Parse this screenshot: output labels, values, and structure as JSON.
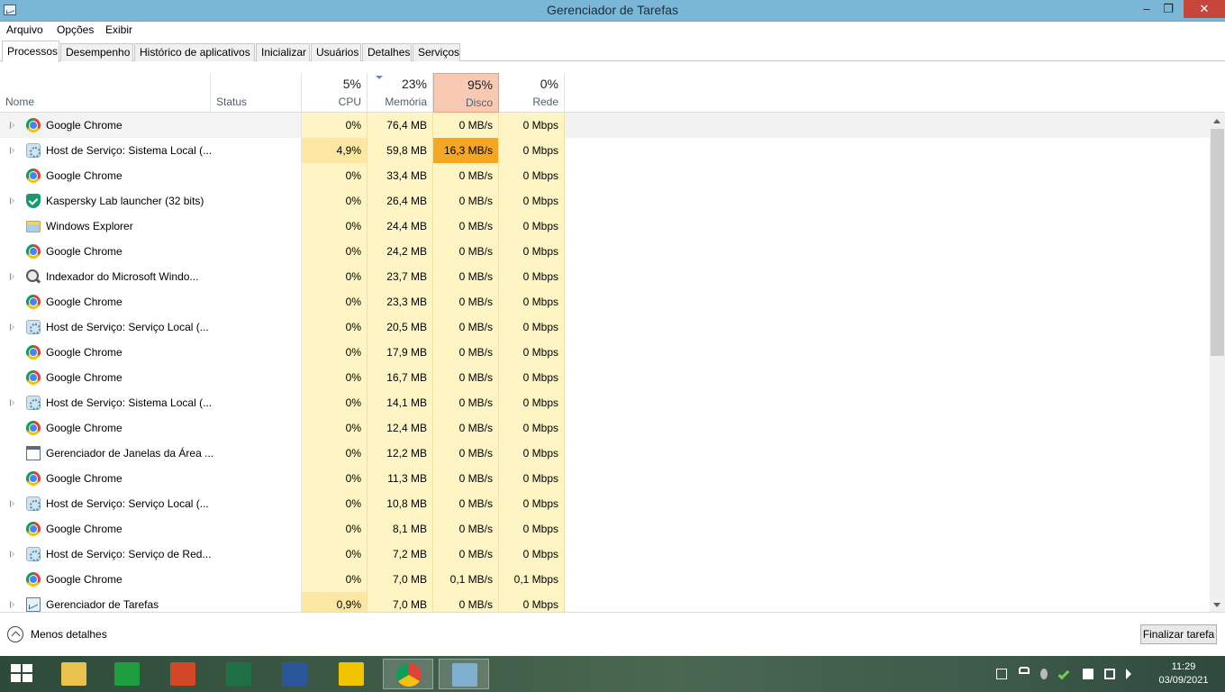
{
  "window": {
    "title": "Gerenciador de Tarefas"
  },
  "menu": [
    "Arquivo",
    "Opções",
    "Exibir"
  ],
  "tabs": [
    {
      "label": "Processos",
      "active": true
    },
    {
      "label": "Desempenho"
    },
    {
      "label": "Histórico de aplicativos"
    },
    {
      "label": "Inicializar"
    },
    {
      "label": "Usuários"
    },
    {
      "label": "Detalhes"
    },
    {
      "label": "Serviços"
    }
  ],
  "columns": {
    "name": "Nome",
    "status": "Status",
    "cpu": {
      "pct": "5%",
      "label": "CPU"
    },
    "memory": {
      "pct": "23%",
      "label": "Memória"
    },
    "disk": {
      "pct": "95%",
      "label": "Disco"
    },
    "network": {
      "pct": "0%",
      "label": "Rede"
    }
  },
  "processes": [
    {
      "name": "Google Chrome",
      "icon": "chrome-icon",
      "expandable": true,
      "cpu": "0%",
      "mem": "76,4 MB",
      "disk": "0 MB/s",
      "net": "0 Mbps",
      "selected": true
    },
    {
      "name": "Host de Serviço: Sistema Local (...",
      "icon": "gear-icon",
      "expandable": true,
      "cpu": "4,9%",
      "mem": "59,8 MB",
      "disk": "16,3 MB/s",
      "net": "0 Mbps",
      "cpu_hot": true,
      "disk_hot": true
    },
    {
      "name": "Google Chrome",
      "icon": "chrome-icon",
      "expandable": false,
      "cpu": "0%",
      "mem": "33,4 MB",
      "disk": "0 MB/s",
      "net": "0 Mbps"
    },
    {
      "name": "Kaspersky Lab launcher (32 bits)",
      "icon": "shield-icon",
      "expandable": true,
      "cpu": "0%",
      "mem": "26,4 MB",
      "disk": "0 MB/s",
      "net": "0 Mbps"
    },
    {
      "name": "Windows Explorer",
      "icon": "folder-icon",
      "expandable": false,
      "cpu": "0%",
      "mem": "24,4 MB",
      "disk": "0 MB/s",
      "net": "0 Mbps"
    },
    {
      "name": "Google Chrome",
      "icon": "chrome-icon",
      "expandable": false,
      "cpu": "0%",
      "mem": "24,2 MB",
      "disk": "0 MB/s",
      "net": "0 Mbps"
    },
    {
      "name": "Indexador do Microsoft Windo...",
      "icon": "indexer-icon",
      "expandable": true,
      "cpu": "0%",
      "mem": "23,7 MB",
      "disk": "0 MB/s",
      "net": "0 Mbps"
    },
    {
      "name": "Google Chrome",
      "icon": "chrome-icon",
      "expandable": false,
      "cpu": "0%",
      "mem": "23,3 MB",
      "disk": "0 MB/s",
      "net": "0 Mbps"
    },
    {
      "name": "Host de Serviço: Serviço Local (...",
      "icon": "gear-icon",
      "expandable": true,
      "cpu": "0%",
      "mem": "20,5 MB",
      "disk": "0 MB/s",
      "net": "0 Mbps"
    },
    {
      "name": "Google Chrome",
      "icon": "chrome-icon",
      "expandable": false,
      "cpu": "0%",
      "mem": "17,9 MB",
      "disk": "0 MB/s",
      "net": "0 Mbps"
    },
    {
      "name": "Google Chrome",
      "icon": "chrome-icon",
      "expandable": false,
      "cpu": "0%",
      "mem": "16,7 MB",
      "disk": "0 MB/s",
      "net": "0 Mbps"
    },
    {
      "name": "Host de Serviço: Sistema Local (...",
      "icon": "gear-icon",
      "expandable": true,
      "cpu": "0%",
      "mem": "14,1 MB",
      "disk": "0 MB/s",
      "net": "0 Mbps"
    },
    {
      "name": "Google Chrome",
      "icon": "chrome-icon",
      "expandable": false,
      "cpu": "0%",
      "mem": "12,4 MB",
      "disk": "0 MB/s",
      "net": "0 Mbps"
    },
    {
      "name": "Gerenciador de Janelas da Área ...",
      "icon": "window-icon",
      "expandable": false,
      "cpu": "0%",
      "mem": "12,2 MB",
      "disk": "0 MB/s",
      "net": "0 Mbps"
    },
    {
      "name": "Google Chrome",
      "icon": "chrome-icon",
      "expandable": false,
      "cpu": "0%",
      "mem": "11,3 MB",
      "disk": "0 MB/s",
      "net": "0 Mbps"
    },
    {
      "name": "Host de Serviço: Serviço Local (...",
      "icon": "gear-icon",
      "expandable": true,
      "cpu": "0%",
      "mem": "10,8 MB",
      "disk": "0 MB/s",
      "net": "0 Mbps"
    },
    {
      "name": "Google Chrome",
      "icon": "chrome-icon",
      "expandable": false,
      "cpu": "0%",
      "mem": "8,1 MB",
      "disk": "0 MB/s",
      "net": "0 Mbps"
    },
    {
      "name": "Host de Serviço: Serviço de Red...",
      "icon": "gear-icon",
      "expandable": true,
      "cpu": "0%",
      "mem": "7,2 MB",
      "disk": "0 MB/s",
      "net": "0 Mbps"
    },
    {
      "name": "Google Chrome",
      "icon": "chrome-icon",
      "expandable": false,
      "cpu": "0%",
      "mem": "7,0 MB",
      "disk": "0,1 MB/s",
      "net": "0,1 Mbps"
    },
    {
      "name": "Gerenciador de Tarefas",
      "icon": "taskmgr-icon",
      "expandable": true,
      "cpu": "0,9%",
      "mem": "7,0 MB",
      "disk": "0 MB/s",
      "net": "0 Mbps",
      "cpu_hot": true
    }
  ],
  "footer": {
    "fewer_details": "Menos detalhes",
    "end_task": "Finalizar tarefa"
  },
  "taskbar": {
    "apps": [
      {
        "name": "file-explorer",
        "color": "#e9c24d"
      },
      {
        "name": "store",
        "color": "#1f9e3f"
      },
      {
        "name": "powerpoint",
        "color": "#d24726"
      },
      {
        "name": "excel",
        "color": "#1e7145"
      },
      {
        "name": "word",
        "color": "#2b579a"
      },
      {
        "name": "pdf-reader",
        "color": "#f2c400"
      },
      {
        "name": "chrome",
        "color": "#4285f4",
        "active": true
      },
      {
        "name": "task-manager",
        "color": "#7fb0d0",
        "active": true
      }
    ],
    "clock": {
      "time": "11:29",
      "date": "03/09/2021"
    }
  }
}
